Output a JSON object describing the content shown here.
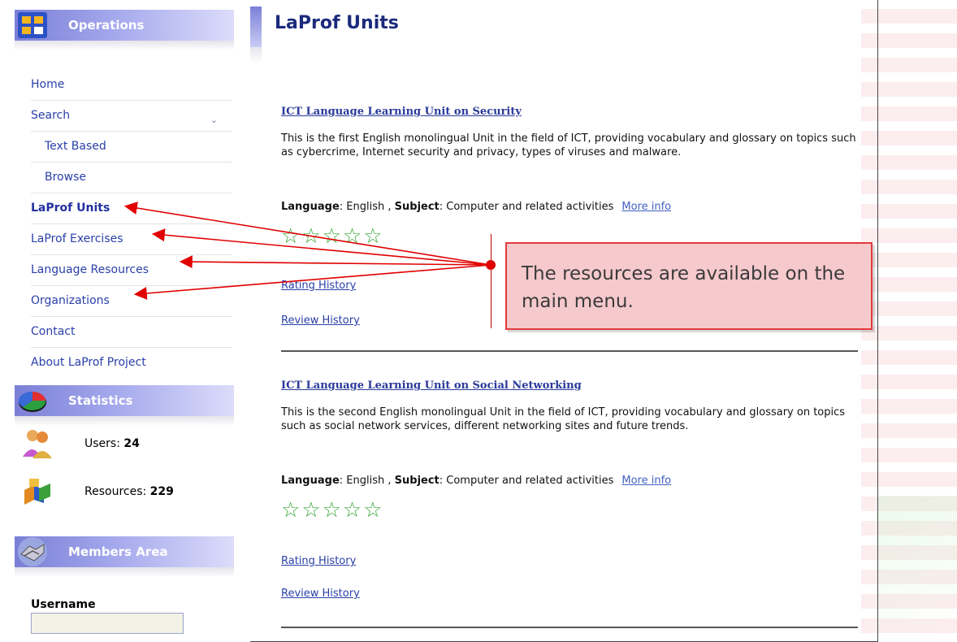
{
  "sidebar": {
    "operations_title": "Operations",
    "menu": [
      {
        "label": "Home"
      },
      {
        "label": "Search"
      },
      {
        "label": "Text Based"
      },
      {
        "label": "Browse"
      },
      {
        "label": "LaProf Units"
      },
      {
        "label": "LaProf Exercises"
      },
      {
        "label": "Language Resources"
      },
      {
        "label": "Organizations"
      },
      {
        "label": "Contact"
      },
      {
        "label": "About LaProf Project"
      }
    ],
    "statistics_title": "Statistics",
    "users_label": "Users:",
    "users_value": "24",
    "resources_label": "Resources:",
    "resources_value": "229",
    "members_title": "Members Area",
    "username_label": "Username"
  },
  "main": {
    "title": "LaProf Units",
    "units": [
      {
        "title": "ICT Language Learning Unit on Security",
        "description": "This is the first English monolingual Unit in the field of ICT, providing vocabulary and glossary on topics such as cybercrime, Internet security and privacy, types of viruses and malware.",
        "language_label": "Language",
        "language": ": English , ",
        "subject_label": "Subject",
        "subject": ": Computer and related activities",
        "more_info": "More info",
        "stars": "☆☆☆☆☆",
        "rating_history": "Rating History",
        "review_history": "Review History"
      },
      {
        "title": "ICT Language Learning Unit on Social Networking",
        "description": "This is the second English monolingual Unit in the field of ICT, providing vocabulary and glossary on topics such as social network services, different networking sites and future trends.",
        "language_label": "Language",
        "language": ": English , ",
        "subject_label": "Subject",
        "subject": ": Computer and related activities",
        "more_info": "More info",
        "stars": "☆☆☆☆☆",
        "rating_history": "Rating History",
        "review_history": "Review History"
      }
    ]
  },
  "callout": {
    "text": "The resources are available on the main menu."
  },
  "colors": {
    "header_blue": "#7a7fd6",
    "link_blue": "#2a3fa8",
    "callout_fill": "#f6c9cc",
    "callout_border": "#e23a3a",
    "arrow_red": "#e00000",
    "star_green": "#3aa83a"
  }
}
